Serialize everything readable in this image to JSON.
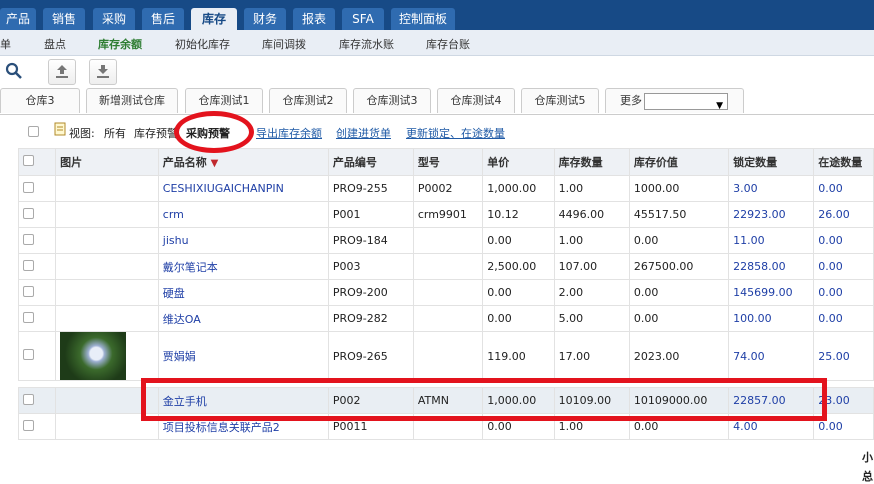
{
  "topnav": {
    "tabs": [
      "产品",
      "销售",
      "采购",
      "售后",
      "库存",
      "财务",
      "报表",
      "SFA",
      "控制面板"
    ],
    "active": "库存"
  },
  "subnav": {
    "items": [
      "单",
      "盘点",
      "库存余额",
      "初始化库存",
      "库间调拨",
      "库存流水账",
      "库存台账"
    ],
    "active": "库存余额"
  },
  "warehouse_tabs": {
    "tabs": [
      "仓库3",
      "新增测试仓库",
      "仓库测试1",
      "仓库测试2",
      "仓库测试3",
      "仓库测试4",
      "仓库测试5"
    ],
    "more_label": "更多",
    "more_value": ""
  },
  "viewbar": {
    "view_label": "视图:",
    "views": [
      "所有",
      "库存预警",
      "采购预警"
    ],
    "links": [
      "导出库存余额",
      "创建进货单",
      "更新锁定、在途数量"
    ]
  },
  "table": {
    "columns": [
      "图片",
      "产品名称",
      "产品编号",
      "型号",
      "单价",
      "库存数量",
      "库存价值",
      "锁定数量",
      "在途数量"
    ],
    "rows": [
      {
        "name": "CESHIXIUGAICHANPIN",
        "code": "PRO9-255",
        "model": "P0002",
        "price": "1,000.00",
        "qty": "1.00",
        "value": "1000.00",
        "locked": "3.00",
        "transit": "0.00"
      },
      {
        "name": "crm",
        "code": "P001",
        "model": "crm9901",
        "price": "10.12",
        "qty": "4496.00",
        "value": "45517.50",
        "locked": "22923.00",
        "transit": "26.00"
      },
      {
        "name": "jishu",
        "code": "PRO9-184",
        "model": "",
        "price": "0.00",
        "qty": "1.00",
        "value": "0.00",
        "locked": "11.00",
        "transit": "0.00"
      },
      {
        "name": "戴尔笔记本",
        "code": "P003",
        "model": "",
        "price": "2,500.00",
        "qty": "107.00",
        "value": "267500.00",
        "locked": "22858.00",
        "transit": "0.00"
      },
      {
        "name": "硬盘",
        "code": "PRO9-200",
        "model": "",
        "price": "0.00",
        "qty": "2.00",
        "value": "0.00",
        "locked": "145699.00",
        "transit": "0.00"
      },
      {
        "name": "维达OA",
        "code": "PRO9-282",
        "model": "",
        "price": "0.00",
        "qty": "5.00",
        "value": "0.00",
        "locked": "100.00",
        "transit": "0.00"
      },
      {
        "name": "贾娟娟",
        "code": "PRO9-265",
        "model": "",
        "price": "119.00",
        "qty": "17.00",
        "value": "2023.00",
        "locked": "74.00",
        "transit": "25.00"
      },
      {
        "name": "金立手机",
        "code": "P002",
        "model": "ATMN",
        "price": "1,000.00",
        "qty": "10109.00",
        "value": "10109000.00",
        "locked": "22857.00",
        "transit": "23.00"
      },
      {
        "name": "项目投标信息关联产品2",
        "code": "P0011",
        "model": "",
        "price": "0.00",
        "qty": "1.00",
        "value": "0.00",
        "locked": "4.00",
        "transit": "0.00"
      }
    ],
    "footer": [
      "小",
      "总"
    ]
  },
  "colors": {
    "nav_bg": "#174a86",
    "highlight": "#e3131d",
    "link": "#1f5aa6"
  }
}
